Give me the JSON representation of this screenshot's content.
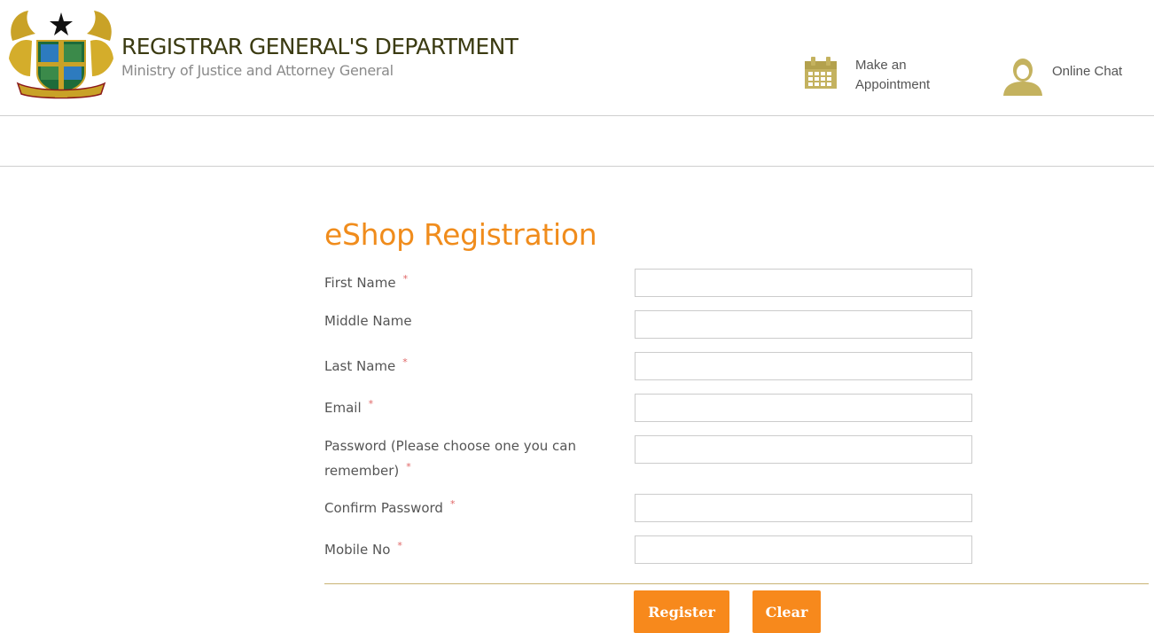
{
  "header": {
    "title": "REGISTRAR GENERAL'S DEPARTMENT",
    "subtitle": "Ministry of Justice and Attorney General",
    "crest_icon": "ghana-coat-of-arms",
    "appointment": {
      "label": "Make an\nAppointment",
      "icon": "calendar-icon"
    },
    "chat": {
      "label": "Online Chat",
      "icon": "person-icon"
    }
  },
  "form": {
    "title": "eShop Registration",
    "required_marker": "*",
    "fields": [
      {
        "label": "First Name",
        "required": true,
        "value": ""
      },
      {
        "label": "Middle Name",
        "required": false,
        "value": ""
      },
      {
        "label": "Last Name",
        "required": true,
        "value": ""
      },
      {
        "label": "Email",
        "required": true,
        "value": ""
      },
      {
        "label": "Password (Please choose one you can remember)",
        "required": true,
        "value": ""
      },
      {
        "label": "Confirm Password",
        "required": true,
        "value": ""
      },
      {
        "label": "Mobile No",
        "required": true,
        "value": ""
      }
    ],
    "buttons": {
      "register": "Register",
      "clear": "Clear"
    }
  },
  "colors": {
    "accent": "#f7891c",
    "title_orange": "#f08c1c",
    "icon_olive": "#c4b25f",
    "required_red": "#e06666"
  }
}
